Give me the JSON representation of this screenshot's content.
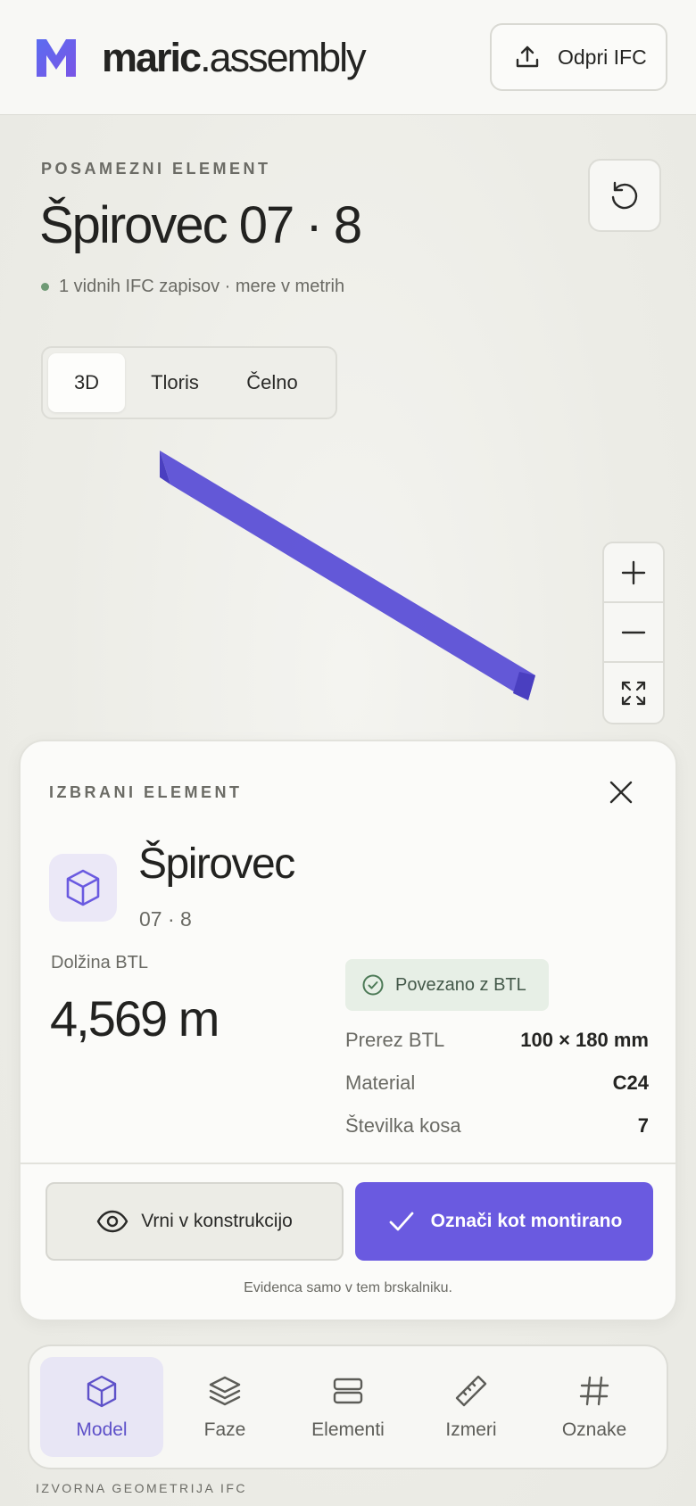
{
  "header": {
    "brand_bold": "maric",
    "brand_rest": ".assembly",
    "open_button": "Odpri IFC"
  },
  "title_area": {
    "eyebrow": "POSAMEZNI ELEMENT",
    "title": "Špirovec 07 · 8",
    "status": "1 vidnih IFC zapisov · mere v metrih"
  },
  "view_tabs": [
    {
      "label": "3D",
      "active": true
    },
    {
      "label": "Tloris",
      "active": false
    },
    {
      "label": "Čelno",
      "active": false
    }
  ],
  "panel": {
    "eyebrow": "IZBRANI ELEMENT",
    "element_name": "Špirovec",
    "element_code": "07 · 8",
    "length_label": "Dolžina BTL",
    "length_value": "4,569 m",
    "linked_badge": "Povezano z BTL",
    "specs": [
      {
        "key": "Prerez BTL",
        "value": "100 × 180 mm"
      },
      {
        "key": "Material",
        "value": "C24"
      },
      {
        "key": "Številka kosa",
        "value": "7"
      }
    ],
    "return_button": "Vrni v konstrukcijo",
    "mount_button": "Označi kot montirano",
    "note": "Evidenca samo v tem brskalniku."
  },
  "bottom_nav": [
    {
      "label": "Model",
      "icon": "cube-icon",
      "active": true
    },
    {
      "label": "Faze",
      "icon": "layers-icon",
      "active": false
    },
    {
      "label": "Elementi",
      "icon": "rows-icon",
      "active": false
    },
    {
      "label": "Izmeri",
      "icon": "ruler-icon",
      "active": false
    },
    {
      "label": "Oznake",
      "icon": "hash-icon",
      "active": false
    }
  ],
  "footnote": "IZVORNA GEOMETRIJA IFC",
  "colors": {
    "accent": "#6a5ae0",
    "beam": "#5b4fd6",
    "success_bg": "#e7efe6",
    "status_dot": "#6f9a75"
  }
}
